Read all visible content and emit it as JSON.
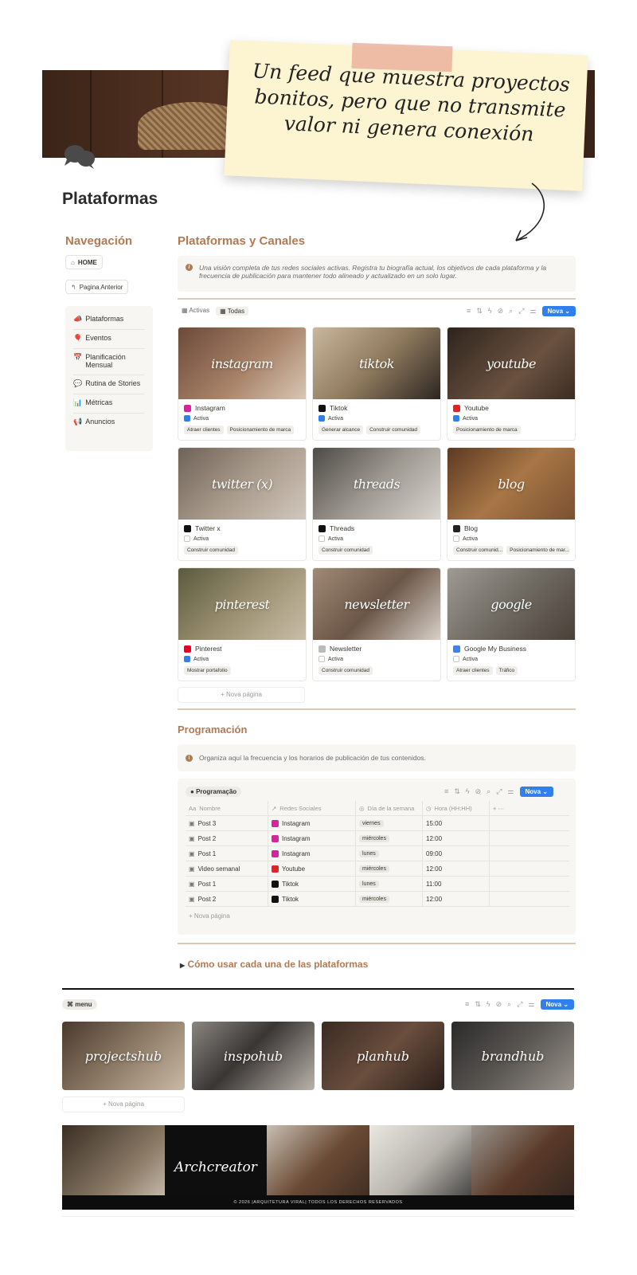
{
  "sticky_note": {
    "text": "Un feed que muestra proyectos bonitos, pero que no transmite valor ni genera conexión"
  },
  "page": {
    "title": "Plataformas"
  },
  "sidebar": {
    "heading": "Navegación",
    "home_label": "HOME",
    "back_label": "Pagina Anterior",
    "items": [
      {
        "label": "Plataformas",
        "icon": "megaphone-icon"
      },
      {
        "label": "Eventos",
        "icon": "balloon-icon"
      },
      {
        "label": "Planificación Mensual",
        "icon": "calendar-icon"
      },
      {
        "label": "Rutina de Stories",
        "icon": "chat-icon"
      },
      {
        "label": "Métricas",
        "icon": "chart-icon"
      },
      {
        "label": "Anuncios",
        "icon": "megaphone-icon"
      }
    ]
  },
  "platforms_section": {
    "heading": "Plataformas y Canales",
    "callout": "Una visión completa de tus redes sociales activas. Registra tu biografía actual, los objetivos de cada plataforma y la frecuencia de publicación para mantener todo alineado y actualizado en un solo lugar.",
    "view_tabs": [
      "Activas",
      "Todas"
    ],
    "new_button": "Nova",
    "new_page": "+ Nova página",
    "cards": [
      {
        "image_text": "instagram",
        "title": "Instagram",
        "active": true,
        "tags": [
          "Atraer clientes",
          "Posicionamiento de marca"
        ],
        "icon_color": "#d6249f",
        "bg": "linear-gradient(135deg,#6b4a3a,#a88268 55%,#d8c6b4)"
      },
      {
        "image_text": "tiktok",
        "title": "Tiktok",
        "active": true,
        "tags": [
          "Generar alcance",
          "Construir comunidad"
        ],
        "icon_color": "#111111",
        "bg": "linear-gradient(135deg,#c9b79d,#8f7a5e 50%,#2c2621)"
      },
      {
        "image_text": "youtube",
        "title": "Youtube",
        "active": true,
        "tags": [
          "Posicionamiento de marca"
        ],
        "icon_color": "#e02424",
        "bg": "linear-gradient(135deg,#2d241d,#6b5240 60%,#3a2c22)"
      },
      {
        "image_text": "twitter (x)",
        "title": "Twitter x",
        "active": false,
        "tags": [
          "Construir comunidad"
        ],
        "icon_color": "#111111",
        "bg": "linear-gradient(135deg,#6e6257,#a89a8b 50%,#d1c7bc)"
      },
      {
        "image_text": "threads",
        "title": "Threads",
        "active": false,
        "tags": [
          "Construir comunidad"
        ],
        "icon_color": "#111111",
        "bg": "linear-gradient(135deg,#4e4a46,#9d9890 50%,#d9d5cf)"
      },
      {
        "image_text": "blog",
        "title": "Blog",
        "active": false,
        "tags": [
          "Construir comunid...",
          "Posicionamiento de mar..."
        ],
        "icon_color": "#222222",
        "bg": "linear-gradient(135deg,#5b3a22,#a87646 50%,#7a5130)"
      },
      {
        "image_text": "pinterest",
        "title": "Pinterest",
        "active": true,
        "tags": [
          "Mostrar portafolio"
        ],
        "icon_color": "#e60023",
        "bg": "linear-gradient(135deg,#5a5a3e,#9b8f70 50%,#c9bda8)"
      },
      {
        "image_text": "newsletter",
        "title": "Newsletter",
        "active": false,
        "tags": [
          "Construir comunidad"
        ],
        "icon_color": "#bbbbbb",
        "bg": "linear-gradient(135deg,#a08a76,#6b5647 50%,#d8d0c8)"
      },
      {
        "image_text": "google",
        "title": "Google My Business",
        "active": false,
        "tags": [
          "Atraer clientes",
          "Tráfico"
        ],
        "icon_color": "#3b82f6",
        "bg": "linear-gradient(135deg,#9f9a93,#6f6a62 50%,#4a4038)"
      }
    ],
    "status_label": "Activa"
  },
  "programacion": {
    "heading": "Programación",
    "callout": "Organiza aquí la frecuencia y los horarios de publicación de tus contenidos.",
    "view_label": "Programação",
    "new_button": "Nova",
    "columns": [
      "Nombre",
      "Redes Sociales",
      "Día de la semana",
      "Hora (HH:HH)"
    ],
    "rows": [
      {
        "name": "Post 3",
        "network": "Instagram",
        "day": "viernes",
        "time": "15:00",
        "net_color": "#d6249f"
      },
      {
        "name": "Post 2",
        "network": "Instagram",
        "day": "miércoles",
        "time": "12:00",
        "net_color": "#d6249f"
      },
      {
        "name": "Post 1",
        "network": "Instagram",
        "day": "lunes",
        "time": "09:00",
        "net_color": "#d6249f"
      },
      {
        "name": "Video semanal",
        "network": "Youtube",
        "day": "miércoles",
        "time": "12:00",
        "net_color": "#e02424"
      },
      {
        "name": "Post 1",
        "network": "Tiktok",
        "day": "lunes",
        "time": "11:00",
        "net_color": "#111111"
      },
      {
        "name": "Post 2",
        "network": "Tiktok",
        "day": "miércoles",
        "time": "12:00",
        "net_color": "#111111"
      }
    ],
    "new_page": "+ Nova página"
  },
  "toggle_section": {
    "heading": "Cómo usar cada una de las plataformas"
  },
  "menu_section": {
    "view_label": "menu",
    "new_button": "Nova",
    "new_page": "+ Nova página",
    "hubs": [
      {
        "label": "projectshub",
        "bg": "linear-gradient(135deg,#4a3a2c,#8c7a66 50%,#c9b9a4)"
      },
      {
        "label": "inspohub",
        "bg": "linear-gradient(135deg,#8a8580,#3a3634 45%,#b9b3ab)"
      },
      {
        "label": "planhub",
        "bg": "linear-gradient(135deg,#3a2a22,#6a4e3e 50%,#2a1f19)"
      },
      {
        "label": "brandhub",
        "bg": "linear-gradient(135deg,#2a2a2a,#5a5652 50%,#9a948c)"
      }
    ]
  },
  "footer": {
    "brand": "Archcreator",
    "copyright": "© 2026 |ARQUITETURA VIRAL| TODOS LOS DERECHOS RESERVADOS"
  }
}
